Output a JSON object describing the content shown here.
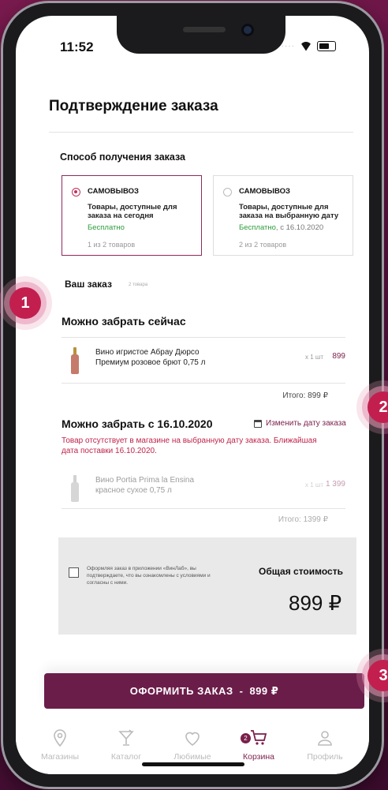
{
  "status_bar": {
    "time": "11:52"
  },
  "page": {
    "title": "Подтверждение заказа"
  },
  "delivery": {
    "label": "Способ получения заказа",
    "options": [
      {
        "title": "САМОВЫВОЗ",
        "desc": "Товары, доступные для заказа на сегодня",
        "price": "Бесплатно",
        "date": "",
        "count": "1 из 2 товаров",
        "selected": true
      },
      {
        "title": "САМОВЫВОЗ",
        "desc": "Товары, доступные для заказа на выбранную дату",
        "price": "Бесплатно",
        "date": ", с 16.10.2020",
        "count": "2 из 2 товаров",
        "selected": false
      }
    ]
  },
  "order": {
    "title": "Ваш заказ",
    "count": "2 товара",
    "now": {
      "title": "Можно забрать сейчас",
      "item_name": "Вино игристое Абрау Дюрсо\nПремиум розовое брют 0,75 л",
      "item_qty": "x 1 шт",
      "item_price": "899",
      "total": "Итого: 899 ₽"
    },
    "later": {
      "title": "Можно забрать с 16.10.2020",
      "change_date": "Изменить дату заказа",
      "warning": "Товар отсутствует в магазине на выбранную дату заказа. Ближайшая дата поставки 16.10.2020.",
      "item_name": "Вино Portia Prima la Ensina\nкрасное сухое 0,75 л",
      "item_qty": "x 1 шт",
      "item_price": "1 399",
      "total": "Итого: 1399 ₽"
    }
  },
  "summary": {
    "agreement": "Оформляя заказ в приложении «ВинЛаб», вы подтверждаете, что вы ознакомлены с условиями и согласны с ними.",
    "total_label": "Общая стоимость",
    "total_value": "899 ₽"
  },
  "checkout": {
    "label": "ОФОРМИТЬ ЗАКАЗ",
    "sep": "-",
    "price": "899 ₽"
  },
  "tabs": [
    {
      "label": "Магазины",
      "icon": "location-pin-icon"
    },
    {
      "label": "Каталог",
      "icon": "cocktail-glass-icon"
    },
    {
      "label": "Любимые",
      "icon": "heart-icon"
    },
    {
      "label": "Корзина",
      "icon": "cart-icon",
      "badge": "2",
      "active": true
    },
    {
      "label": "Профиль",
      "icon": "user-icon"
    }
  ],
  "callouts": [
    "1",
    "2",
    "3"
  ],
  "colors": {
    "brand": "#6b1d4a",
    "accent": "#c0325c",
    "success": "#2a9d3a",
    "warning": "#c0234b"
  }
}
